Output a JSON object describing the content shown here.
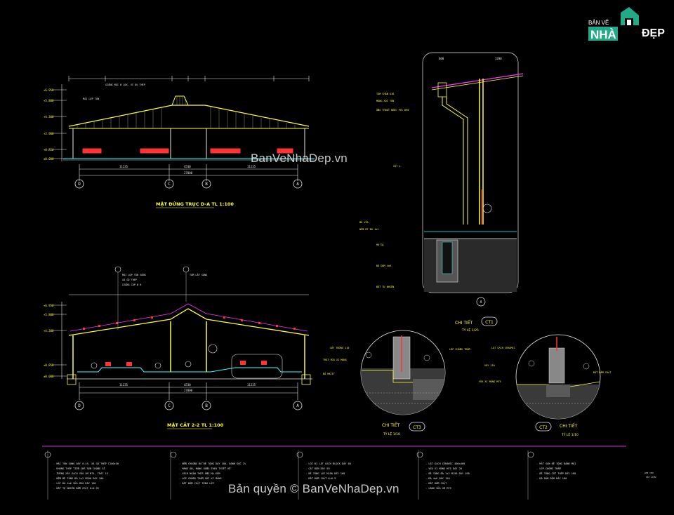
{
  "logo": {
    "top_text": "BẢN VẼ",
    "big_text": "NHÀ",
    "suffix": "ĐẸP"
  },
  "watermarks": {
    "center": "BanVeNhaDep.vn",
    "copyright": "Bản quyền © BanVeNhaDep.vn"
  },
  "views": {
    "elevation_title": "MẶT ĐỨNG TRỤC D-A  TL 1:100",
    "section_title": "MẶT CẮT 2-2  TL 1:100",
    "detail_ct1": "CHI TIẾT",
    "detail_ct1_scale": "TỶ LỆ 1/25",
    "detail_ct3": "CHI TIẾT",
    "detail_ct3_scale": "TỶ LỆ 1/10",
    "detail_ct2": "CHI TIẾT",
    "detail_ct2_scale": "TỶ LỆ 1/10",
    "tag_ct1": "CT1",
    "tag_ct3": "CT3",
    "tag_ct2": "CT2"
  },
  "grid_axes": [
    "D",
    "C",
    "B",
    "A"
  ],
  "dimensions": {
    "bottom_total": "27000",
    "bottom_segments": [
      "11235",
      "4530",
      "11235"
    ],
    "top_segments": [
      "1880",
      "11500",
      "2000",
      "2000",
      "11500",
      "1880"
    ]
  },
  "colors": {
    "bg": "#000000",
    "yellow": "#ffff33",
    "white": "#e8e8e8",
    "red": "#ff3333",
    "magenta": "#ff33ff",
    "green": "#33ff33",
    "cyan": "#33ffff",
    "frame": "#cc33cc"
  }
}
